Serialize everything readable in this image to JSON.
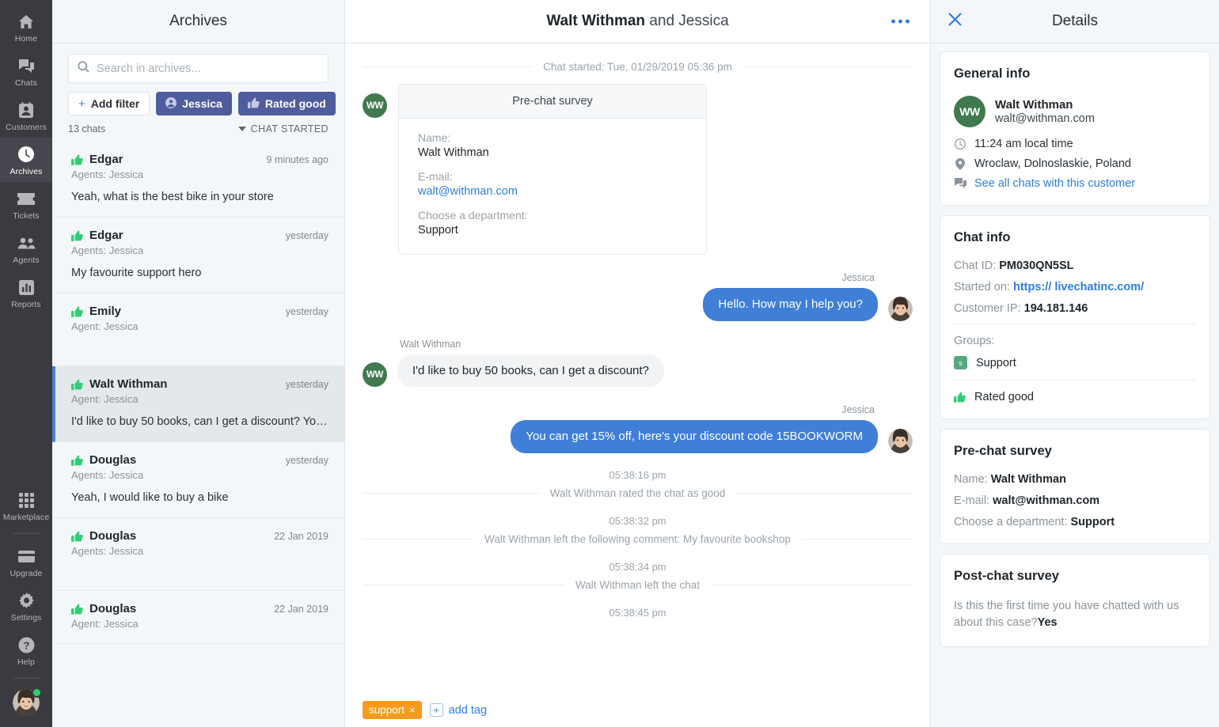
{
  "nav": {
    "items": [
      {
        "label": "Home",
        "icon": "home-icon",
        "active": false
      },
      {
        "label": "Chats",
        "icon": "chats-icon",
        "active": false
      },
      {
        "label": "Customers",
        "icon": "customers-icon",
        "active": false
      },
      {
        "label": "Archives",
        "icon": "clock-icon",
        "active": true
      },
      {
        "label": "Tickets",
        "icon": "ticket-icon",
        "active": false
      },
      {
        "label": "Agents",
        "icon": "agents-icon",
        "active": false
      },
      {
        "label": "Reports",
        "icon": "reports-icon",
        "active": false
      }
    ],
    "bottom_items": [
      {
        "label": "Marketplace",
        "icon": "grid-icon"
      },
      {
        "label": "Upgrade",
        "icon": "card-icon"
      },
      {
        "label": "Settings",
        "icon": "gear-icon"
      },
      {
        "label": "Help",
        "icon": "question-icon"
      }
    ]
  },
  "archives": {
    "title": "Archives",
    "search_placeholder": "Search in archives...",
    "search_value": "",
    "add_filter_label": "Add filter",
    "filters": [
      {
        "label": "Jessica",
        "icon": "person-icon"
      },
      {
        "label": "Rated good",
        "icon": "thumb-up-icon"
      }
    ],
    "count_label": "13 chats",
    "sort_label": "CHAT STARTED",
    "rows": [
      {
        "name": "Edgar",
        "time": "9 minutes ago",
        "agent": "Agents: Jessica",
        "message": "Yeah, what is the best bike in your store",
        "rating": "good",
        "selected": false
      },
      {
        "name": "Edgar",
        "time": "yesterday",
        "agent": "Agents: Jessica",
        "message": "My favourite support hero",
        "rating": "good",
        "selected": false
      },
      {
        "name": "Emily",
        "time": "yesterday",
        "agent": "Agent: Jessica",
        "message": "",
        "rating": "good",
        "selected": false
      },
      {
        "name": "Walt Withman",
        "time": "yesterday",
        "agent": "Agent: Jessica",
        "message": "I'd like to buy 50 books, can I get a discount? You ...",
        "rating": "good",
        "selected": true
      },
      {
        "name": "Douglas",
        "time": "yesterday",
        "agent": "Agents: Jessica",
        "message": "Yeah, I would like to buy a bike",
        "rating": "good",
        "selected": false
      },
      {
        "name": "Douglas",
        "time": "22 Jan 2019",
        "agent": "Agents: Jessica",
        "message": "",
        "rating": "good",
        "selected": false
      },
      {
        "name": "Douglas",
        "time": "22 Jan 2019",
        "agent": "Agent: Jessica",
        "message": "",
        "rating": "good",
        "selected": false
      }
    ]
  },
  "chat": {
    "title_bold": "Walt Withman",
    "title_rest": " and Jessica",
    "started_label": "Chat started: Tue, 01/29/2019 05:36 pm",
    "survey": {
      "header": "Pre-chat survey",
      "name_label": "Name:",
      "name_value": "Walt Withman",
      "email_label": "E-mail:",
      "email_value": "walt@withman.com",
      "dept_label": "Choose a department:",
      "dept_value": "Support"
    },
    "customer_initials": "WW",
    "messages": [
      {
        "side": "right",
        "author": "Jessica",
        "text": "Hello. How may I help you?"
      },
      {
        "side": "left",
        "author": "Walt Withman",
        "text": "I'd like to buy 50 books, can I get a discount?"
      },
      {
        "side": "right",
        "author": "Jessica",
        "text": "You can get 15% off, here's your discount code 15BOOKWORM"
      }
    ],
    "events": [
      {
        "time": "05:38:16 pm",
        "text": "Walt Withman rated the chat as good"
      },
      {
        "time": "05:38:32 pm",
        "text": "Walt Withman left the following comment: My favourite bookshop"
      },
      {
        "time": "05:38:34 pm",
        "text": "Walt Withman left the chat"
      },
      {
        "time": "05:38:45 pm",
        "text": ""
      }
    ],
    "tag_label": "support",
    "tag_remove": "×",
    "add_tag_label": "add tag"
  },
  "details": {
    "title": "Details",
    "general": {
      "title": "General info",
      "initials": "WW",
      "name": "Walt Withman",
      "email": "walt@withman.com",
      "local_time": "11:24 am local time",
      "location": "Wroclaw, Dolnoslaskie, Poland",
      "see_all_chats": "See all chats with this customer"
    },
    "chat_info": {
      "title": "Chat info",
      "chat_id_label": "Chat ID:",
      "chat_id_value": "PM030QN5SL",
      "started_on_label": "Started on:",
      "started_on_value": "https:// livechatinc.com/",
      "customer_ip_label": "Customer IP:",
      "customer_ip_value": "194.181.146",
      "groups_label": "Groups:",
      "group_badge": "s",
      "group_value": "Support",
      "rating_label": "Rated good"
    },
    "pre_chat": {
      "title": "Pre-chat survey",
      "name_label": "Name:",
      "name_value": "Walt Withman",
      "email_label": "E-mail:",
      "email_value": "walt@withman.com",
      "dept_label": "Choose a department:",
      "dept_value": "Support"
    },
    "post_chat": {
      "title": "Post-chat survey",
      "question": "Is this the first time you have chatted with us about this case?",
      "answer": "Yes"
    }
  },
  "colors": {
    "accent_blue": "#2f7de1",
    "bubble_blue": "#3f7fd8",
    "chip_indigo": "#4f5c9d",
    "thumb_green": "#31ce73",
    "avatar_green": "#40794e",
    "tag_orange": "#f89a1c",
    "nav_dark": "#3a3a41"
  }
}
